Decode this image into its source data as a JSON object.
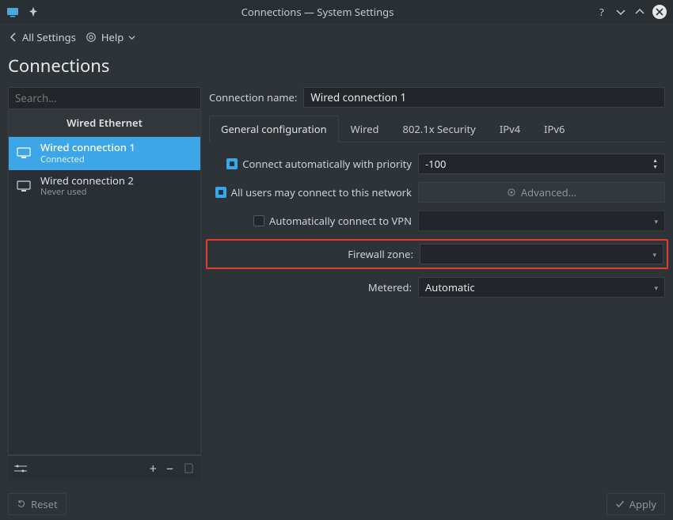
{
  "titlebar": {
    "title": "Connections — System Settings"
  },
  "toolbar": {
    "back": "All Settings",
    "help": "Help"
  },
  "page": {
    "title": "Connections"
  },
  "search": {
    "placeholder": "Search..."
  },
  "sidebar": {
    "group": "Wired Ethernet",
    "items": [
      {
        "name": "Wired connection 1",
        "status": "Connected",
        "selected": true
      },
      {
        "name": "Wired connection 2",
        "status": "Never used",
        "selected": false
      }
    ]
  },
  "detail": {
    "name_label": "Connection name:",
    "name_value": "Wired connection 1"
  },
  "tabs": [
    "General configuration",
    "Wired",
    "802.1x Security",
    "IPv4",
    "IPv6"
  ],
  "form": {
    "auto_connect": {
      "label": "Connect automatically with priority",
      "checked": true,
      "value": "-100"
    },
    "all_users": {
      "label": "All users may connect to this network",
      "checked": true,
      "advanced": "Advanced..."
    },
    "auto_vpn": {
      "label": "Automatically connect to VPN",
      "checked": false,
      "value": ""
    },
    "firewall": {
      "label": "Firewall zone:",
      "value": ""
    },
    "metered": {
      "label": "Metered:",
      "value": "Automatic"
    }
  },
  "footer": {
    "reset": "Reset",
    "apply": "Apply"
  }
}
